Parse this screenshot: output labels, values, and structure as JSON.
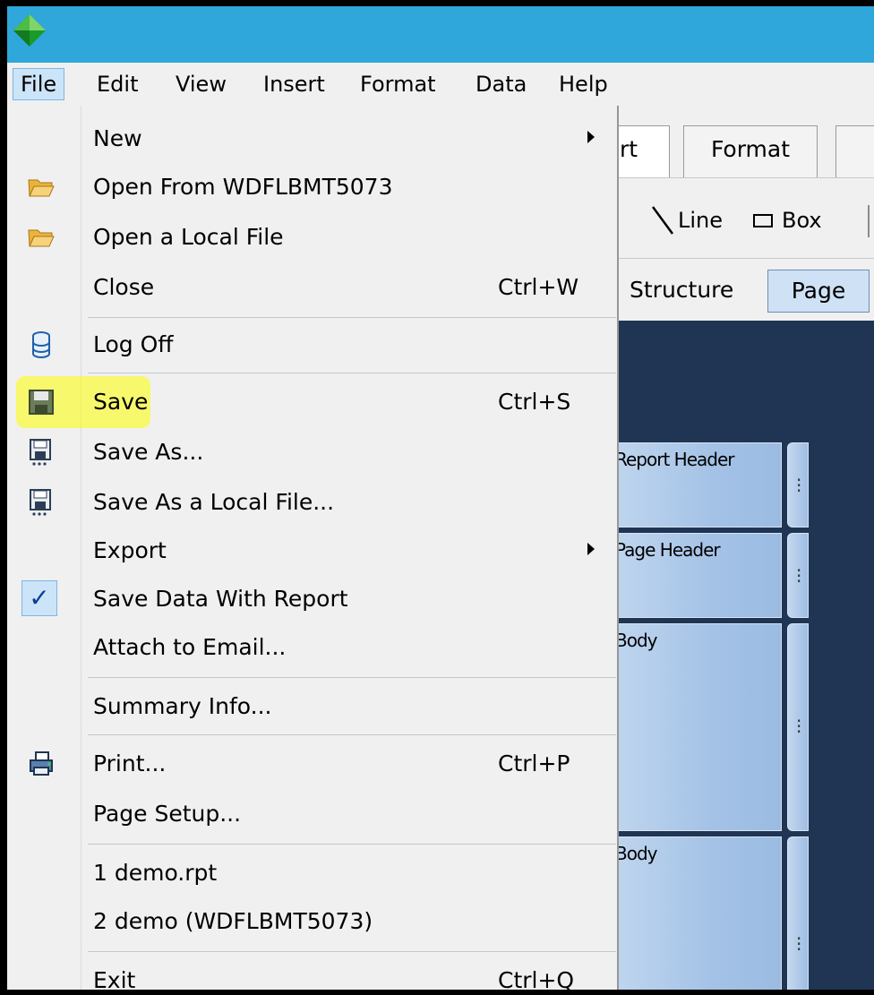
{
  "menubar": {
    "items": [
      {
        "label": "File",
        "active": true
      },
      {
        "label": "Edit"
      },
      {
        "label": "View"
      },
      {
        "label": "Insert"
      },
      {
        "label": "Format"
      },
      {
        "label": "Data"
      },
      {
        "label": "Help"
      }
    ]
  },
  "background": {
    "tabs": [
      "rt",
      "Format"
    ],
    "tools": {
      "line": "Line",
      "box": "Box"
    },
    "view_buttons": {
      "structure": "Structure",
      "page": "Page"
    },
    "sections": [
      "Report Header",
      "Page Header",
      "Body",
      "Body"
    ]
  },
  "file_menu": {
    "new": "New",
    "open_from": "Open From WDFLBMT5073",
    "open_local": "Open a Local File",
    "close": "Close",
    "close_shortcut": "Ctrl+W",
    "log_off": "Log Off",
    "save": "Save",
    "save_shortcut": "Ctrl+S",
    "save_as": "Save As...",
    "save_as_local": "Save As a Local File...",
    "export": "Export",
    "save_data": "Save Data With Report",
    "save_data_checked": true,
    "attach_email": "Attach to Email...",
    "summary_info": "Summary Info...",
    "print": "Print...",
    "print_shortcut": "Ctrl+P",
    "page_setup": "Page Setup...",
    "recent_1": "1 demo.rpt",
    "recent_2": "2 demo (WDFLBMT5073)",
    "exit": "Exit",
    "exit_shortcut": "Ctrl+Q"
  },
  "colors": {
    "titlebar": "#2fa7da",
    "canvas": "#1f3553",
    "highlight": "#ffff00"
  }
}
